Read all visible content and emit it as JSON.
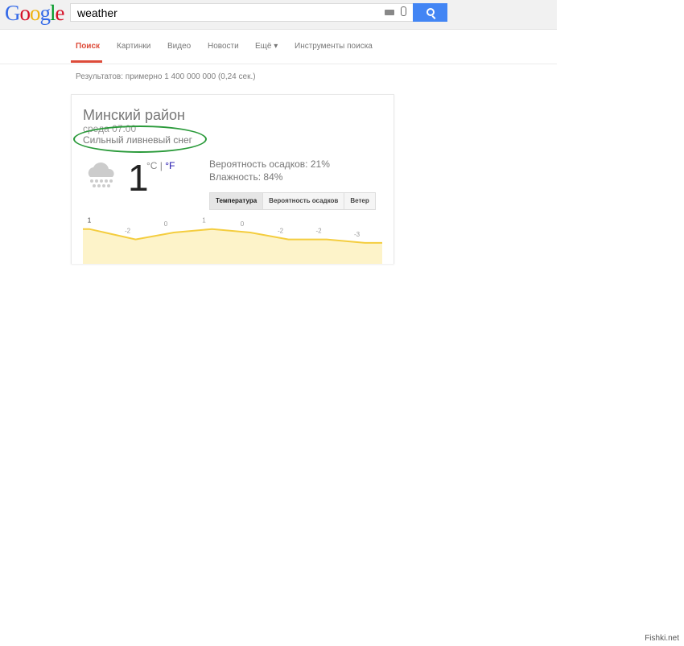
{
  "header": {
    "logo": "Google",
    "query": "weather"
  },
  "tabs": [
    {
      "label": "Поиск",
      "active": true
    },
    {
      "label": "Картинки"
    },
    {
      "label": "Видео"
    },
    {
      "label": "Новости"
    },
    {
      "label": "Ещё ▾"
    },
    {
      "label": "Инструменты поиска"
    }
  ],
  "stats": "Результатов: примерно 1 400 000 000 (0,24 сек.)",
  "weather": {
    "location": "Минский район",
    "time": "среда 07:00",
    "condition": "Сильный ливневый снег",
    "icon": "snow-cloud-icon",
    "temperature": "1",
    "unit_c": "°C",
    "unit_sep": " | ",
    "unit_f": "°F",
    "precipitation": "Вероятность осадков: 21%",
    "humidity": "Влажность: 84%",
    "buttons": [
      "Температура",
      "Вероятность осадков",
      "Ветер"
    ]
  },
  "chart_data": {
    "type": "area",
    "values": [
      1,
      -2,
      0,
      1,
      0,
      -2,
      -2,
      -3
    ],
    "labels": [
      "1",
      "-2",
      "0",
      "1",
      "0",
      "-2",
      "-2",
      "-3"
    ],
    "line_color": "#f4cd3f",
    "fill_color": "#fdf3c9"
  },
  "watermark": "Fishki.net",
  "colors": {
    "accent": "#dd4b39",
    "search_button": "#4285f4",
    "annotation": "#2a9a3a"
  }
}
